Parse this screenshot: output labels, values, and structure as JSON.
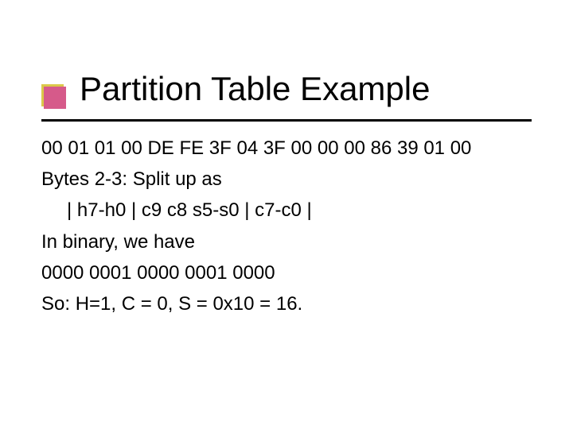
{
  "slide": {
    "title": "Partition Table Example",
    "hex_line": "00 01 01 00 DE FE 3F 04 3F 00 00 00 86 39 01 00",
    "line_bytes": "Bytes 2-3: Split up as",
    "line_layout": "| h7-h0 | c9 c8 s5-s0 | c7-c0 |",
    "line_binary_intro": "In binary, we have",
    "line_binary_bits": "0000 0001 0000 0001 0000",
    "line_result": "So: H=1, C = 0, S = 0x10 = 16."
  }
}
